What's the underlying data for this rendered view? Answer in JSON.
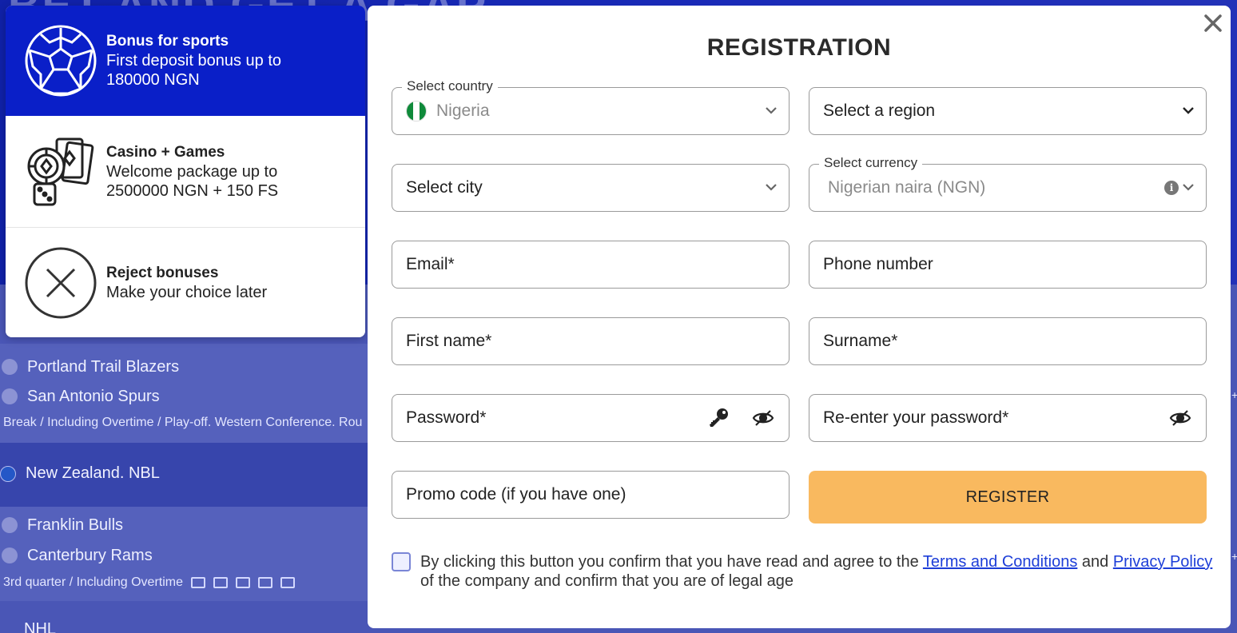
{
  "background": {
    "hero_text": "BET AND GET A GAP",
    "event1": {
      "team1": "Portland Trail Blazers",
      "team2": "San Antonio Spurs",
      "meta": "Break / Including Overtime / Play-off. Western Conference. Rou"
    },
    "league": "New Zealand. NBL",
    "event2": {
      "team1": "Franklin Bulls",
      "team2": "Canterbury Rams",
      "meta": "3rd quarter / Including Overtime"
    },
    "league2": "NHL"
  },
  "bonuses": [
    {
      "title": "Bonus for sports",
      "description": "First deposit bonus up to 180000 NGN",
      "icon": "soccer-ball-icon",
      "selected": true
    },
    {
      "title": "Casino + Games",
      "description": "Welcome package up to 2500000 NGN + 150 FS",
      "icon": "casino-chips-cards-icon",
      "selected": false
    },
    {
      "title": "Reject bonuses",
      "description": "Make your choice later",
      "icon": "reject-x-icon",
      "selected": false
    }
  ],
  "registration": {
    "title": "REGISTRATION",
    "country": {
      "label": "Select country",
      "value": "Nigeria"
    },
    "region": {
      "placeholder": "Select a region"
    },
    "city": {
      "placeholder": "Select city"
    },
    "currency": {
      "label": "Select currency",
      "value": "Nigerian naira (NGN)"
    },
    "email": {
      "placeholder": "Email*"
    },
    "phone": {
      "placeholder": "Phone number"
    },
    "first_name": {
      "placeholder": "First name*"
    },
    "surname": {
      "placeholder": "Surname*"
    },
    "password": {
      "placeholder": "Password*"
    },
    "password_repeat": {
      "placeholder": "Re-enter your password*"
    },
    "promo": {
      "placeholder": "Promo code (if you have one)"
    },
    "register_label": "REGISTER",
    "consent": {
      "before": "By clicking this button you confirm that you have read and agree to the ",
      "terms_link": "Terms and Conditions",
      "middle": " and ",
      "privacy_link": "Privacy Policy",
      "after": " of the company and confirm that you are of legal age",
      "checked": false
    }
  },
  "colors": {
    "sports_bonus_bg": "#0a1fc8",
    "register_button": "#f9b95f",
    "link": "#1d3ed8",
    "flag_green": "#0f8a3a"
  }
}
